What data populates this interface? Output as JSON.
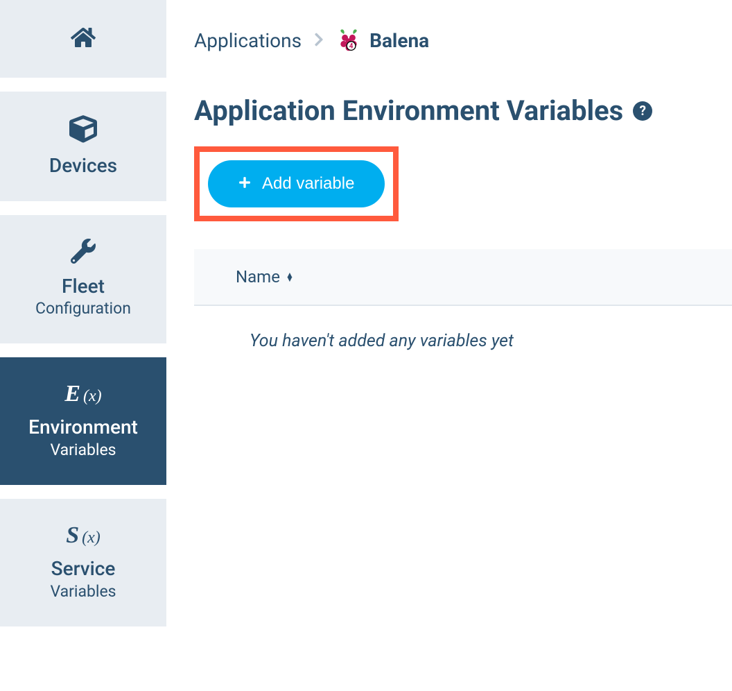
{
  "sidebar": {
    "items": [
      {
        "id": "home",
        "main": "",
        "sub": ""
      },
      {
        "id": "devices",
        "main": "Devices",
        "sub": ""
      },
      {
        "id": "fleet",
        "main": "Fleet",
        "sub": "Configuration"
      },
      {
        "id": "environment",
        "main": "Environment",
        "sub": "Variables",
        "iconLetter": "E"
      },
      {
        "id": "service",
        "main": "Service",
        "sub": "Variables",
        "iconLetter": "S"
      }
    ]
  },
  "breadcrumb": {
    "root": "Applications",
    "current": "Balena"
  },
  "page": {
    "title": "Application Environment Variables",
    "help": "?"
  },
  "actions": {
    "addVariable": "Add variable"
  },
  "table": {
    "columns": [
      {
        "label": "Name"
      }
    ],
    "emptyMessage": "You haven't added any variables yet"
  },
  "colors": {
    "primary": "#2a506f",
    "accent": "#00aeef",
    "highlight": "#ff5a3d",
    "sidebarBg": "#e8edf2"
  }
}
